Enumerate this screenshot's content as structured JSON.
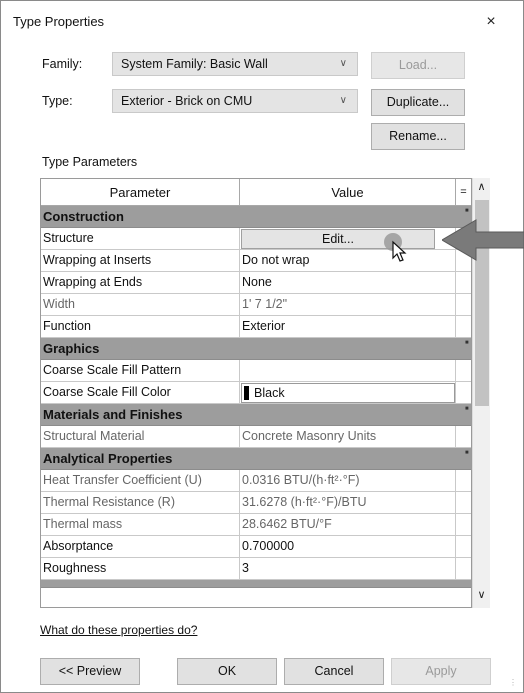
{
  "window": {
    "title": "Type Properties",
    "close_glyph": "×"
  },
  "family": {
    "label": "Family:",
    "value": "System Family: Basic Wall"
  },
  "type": {
    "label": "Type:",
    "value": "Exterior - Brick on CMU"
  },
  "buttons": {
    "load": "Load...",
    "duplicate": "Duplicate...",
    "rename": "Rename...",
    "preview": "<< Preview",
    "ok": "OK",
    "cancel": "Cancel",
    "apply": "Apply"
  },
  "section_label": "Type Parameters",
  "grid": {
    "headers": {
      "parameter": "Parameter",
      "value": "Value",
      "eq": "="
    },
    "groups": {
      "construction": "Construction",
      "graphics": "Graphics",
      "materials": "Materials and Finishes",
      "analytical": "Analytical Properties"
    },
    "rows": {
      "structure": {
        "param": "Structure",
        "value": "Edit..."
      },
      "wrap_inserts": {
        "param": "Wrapping at Inserts",
        "value": "Do not wrap"
      },
      "wrap_ends": {
        "param": "Wrapping at Ends",
        "value": "None"
      },
      "width": {
        "param": "Width",
        "value": "1'  7 1/2\""
      },
      "function": {
        "param": "Function",
        "value": "Exterior"
      },
      "fill_pattern": {
        "param": "Coarse Scale Fill Pattern",
        "value": ""
      },
      "fill_color": {
        "param": "Coarse Scale Fill Color",
        "value": "Black",
        "swatch": "#000000"
      },
      "structural_material": {
        "param": "Structural Material",
        "value": "Concrete Masonry Units"
      },
      "heat_transfer": {
        "param": "Heat Transfer Coefficient (U)",
        "value": "0.0316 BTU/(h·ft²·°F)"
      },
      "thermal_resistance": {
        "param": "Thermal Resistance (R)",
        "value": "31.6278 (h·ft²·°F)/BTU"
      },
      "thermal_mass": {
        "param": "Thermal mass",
        "value": "28.6462 BTU/°F"
      },
      "absorptance": {
        "param": "Absorptance",
        "value": "0.700000"
      },
      "roughness": {
        "param": "Roughness",
        "value": "3"
      }
    }
  },
  "help_link": "What do these properties do?",
  "icons": {
    "close": "close-icon",
    "dropdown": "chevron-down-icon",
    "scroll_up": "chevron-up-icon",
    "scroll_down": "chevron-down-icon",
    "callout": "arrow-left-icon",
    "cursor": "mouse-pointer-icon"
  },
  "colors": {
    "group_header": "#9d9d9d",
    "callout_arrow": "#7a7a7a",
    "dialog_bg": "#ffffff"
  }
}
